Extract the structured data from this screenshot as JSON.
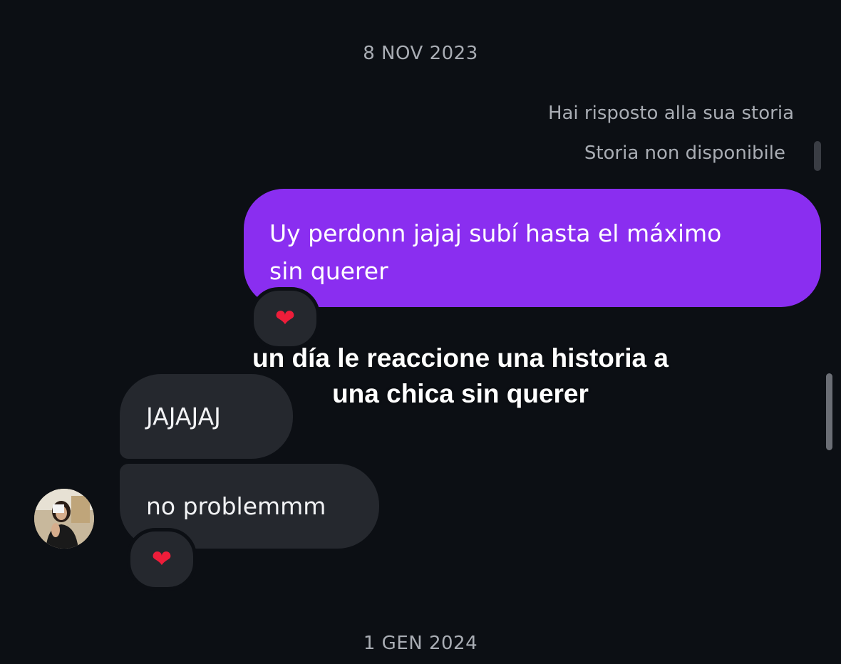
{
  "dates": {
    "top": "8 NOV 2023",
    "bottom": "1 GEN 2024"
  },
  "story": {
    "replied_label": "Hai risposto alla sua storia",
    "unavailable_label": "Storia non disponibile"
  },
  "messages": {
    "sent": {
      "line1": "Uy perdonn jajaj subí hasta el máximo",
      "line2": "sin querer",
      "reaction": "❤"
    },
    "received": [
      {
        "text": "JAJAJAJ"
      },
      {
        "text": "no problemmm",
        "reaction": "❤"
      }
    ]
  },
  "overlay_caption": {
    "line1": "un día le reaccione una historia a",
    "line2": "una chica sin querer"
  },
  "icons": {
    "reaction_icon": "heart-icon",
    "avatar": "contact-avatar"
  },
  "colors": {
    "background": "#0c0f14",
    "sent_bubble": "#8a2ef0",
    "received_bubble": "#25282e",
    "heart": "#ee1d3a"
  }
}
